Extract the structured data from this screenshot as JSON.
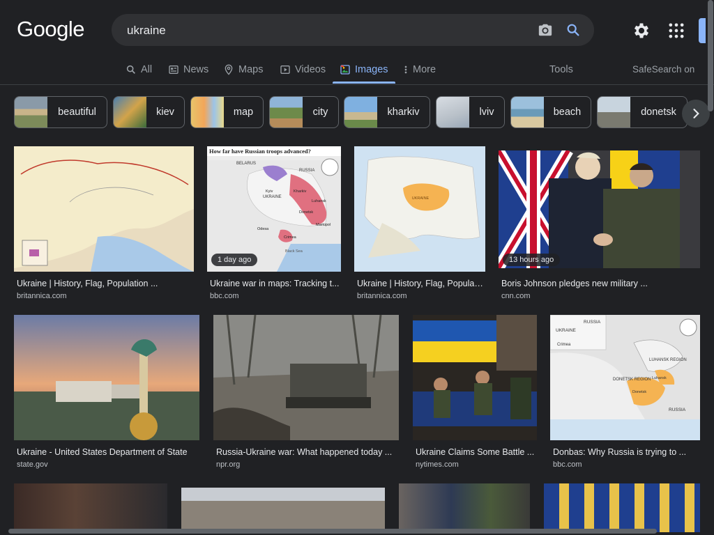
{
  "logo": "Google",
  "search": {
    "query": "ukraine"
  },
  "tabs": [
    {
      "label": "All"
    },
    {
      "label": "News"
    },
    {
      "label": "Maps"
    },
    {
      "label": "Videos"
    },
    {
      "label": "Images"
    },
    {
      "label": "More"
    }
  ],
  "tools": "Tools",
  "safesearch": "SafeSearch on",
  "chips": [
    {
      "label": "beautiful"
    },
    {
      "label": "kiev"
    },
    {
      "label": "map"
    },
    {
      "label": "city"
    },
    {
      "label": "kharkiv"
    },
    {
      "label": "lviv"
    },
    {
      "label": "beach"
    },
    {
      "label": "donetsk"
    }
  ],
  "results": [
    {
      "title": "Ukraine | History, Flag, Population ...",
      "source": "britannica.com",
      "badge": ""
    },
    {
      "title": "Ukraine war in maps: Tracking t...",
      "source": "bbc.com",
      "badge": "1 day ago"
    },
    {
      "title": "Ukraine | History, Flag, Populati...",
      "source": "britannica.com",
      "badge": ""
    },
    {
      "title": "Boris Johnson pledges new military ...",
      "source": "cnn.com",
      "badge": "13 hours ago"
    },
    {
      "title": "Ukraine - United States Department of State",
      "source": "state.gov",
      "badge": ""
    },
    {
      "title": "Russia-Ukraine war: What happened today ...",
      "source": "npr.org",
      "badge": ""
    },
    {
      "title": "Ukraine Claims Some Battle ...",
      "source": "nytimes.com",
      "badge": ""
    },
    {
      "title": "Donbas: Why Russia is trying to ...",
      "source": "bbc.com",
      "badge": ""
    }
  ],
  "image_texts": {
    "bbc_map_title": "How far have Russian troops advanced?",
    "bbc_map_labels": [
      "BELARUS",
      "RUSSIA",
      "Kyiv",
      "UKRAINE",
      "Kharkiv",
      "Luhansk",
      "Donetsk",
      "Mariupol",
      "Odesa",
      "Crimea",
      "Black Sea"
    ],
    "europe_map_label": "UKRAINE",
    "donbas_map_labels": [
      "RUSSIA",
      "UKRAINE",
      "Crimea",
      "LUHANSK REGION",
      "DONETSK REGION",
      "Luhansk",
      "Donetsk",
      "RUSSIA"
    ]
  },
  "colors": {
    "accent": "#8ab4f8",
    "bg": "#202124",
    "surface": "#303134"
  }
}
